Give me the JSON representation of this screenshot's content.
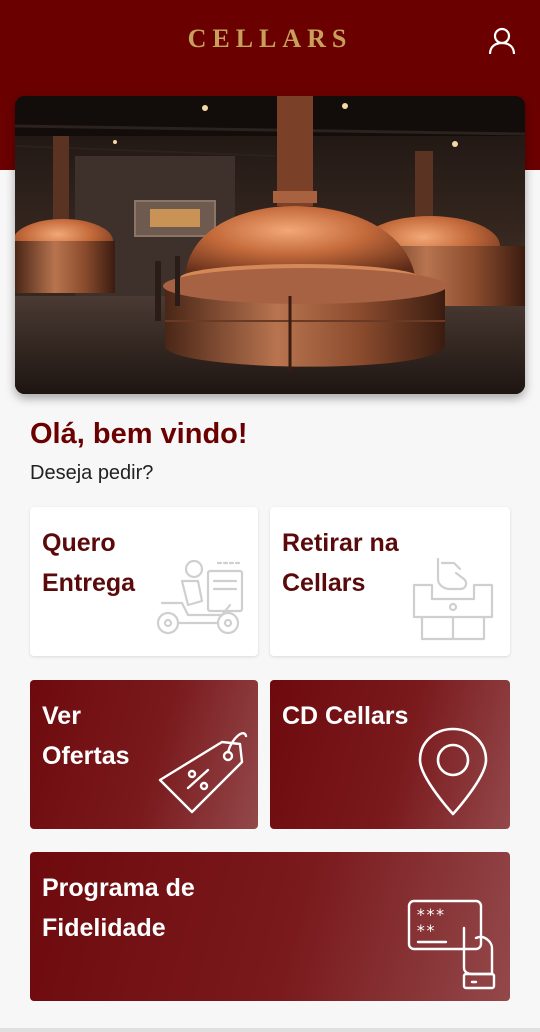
{
  "header": {
    "brand": "CELLARS",
    "user_icon": "user-icon",
    "background_color": "#6b0000",
    "brand_color": "#c7a15b"
  },
  "hero": {
    "image": "brewery-copper-kettles-photo"
  },
  "welcome": {
    "greeting": "Olá, bem vindo!",
    "question": "Deseja pedir?"
  },
  "cards": [
    {
      "line1": "Quero",
      "line2": "Entrega",
      "icon": "delivery-scooter-icon",
      "style": "white"
    },
    {
      "line1": "Retirar na",
      "line2": "Cellars",
      "icon": "store-pickup-icon",
      "style": "white"
    },
    {
      "line1": "Ver",
      "line2": "Ofertas",
      "icon": "price-tag-icon",
      "style": "red"
    },
    {
      "line1": "CD Cellars",
      "line2": "",
      "icon": "map-pin-icon",
      "style": "red"
    },
    {
      "line1": "Programa de",
      "line2": "Fidelidade",
      "icon": "loyalty-card-icon",
      "style": "red"
    }
  ],
  "accent_colors": {
    "primary": "#6b0000",
    "card_text_dark": "#5a0a0a"
  }
}
